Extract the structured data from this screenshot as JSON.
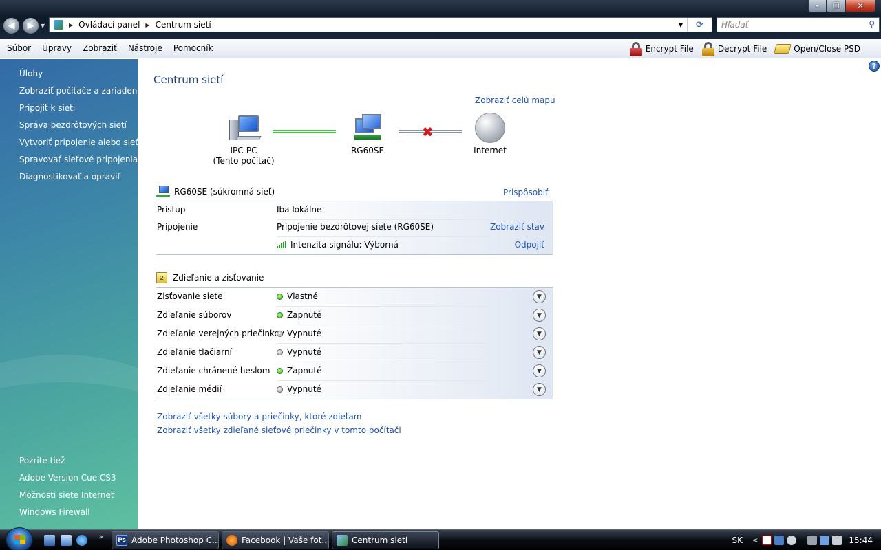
{
  "window": {
    "address": {
      "crumbs": [
        "Ovládací panel",
        "Centrum sietí"
      ]
    },
    "search_placeholder": "Hľadať"
  },
  "menu": {
    "items": [
      "Súbor",
      "Úpravy",
      "Zobraziť",
      "Nástroje",
      "Pomocník"
    ],
    "tools": {
      "encrypt": "Encrypt File",
      "decrypt": "Decrypt File",
      "psd": "Open/Close PSD"
    }
  },
  "sidebar": {
    "tasks_heading": "Úlohy",
    "tasks": [
      "Zobraziť počítače a zariadenia",
      "Pripojiť k sieti",
      "Správa bezdrôtových sietí",
      "Vytvoriť pripojenie alebo sieť",
      "Spravovať sieťové pripojenia",
      "Diagnostikovať a opraviť"
    ],
    "see_also_heading": "Pozrite tiež",
    "see_also": [
      "Adobe Version Cue CS3",
      "Možnosti siete Internet",
      "Windows Firewall"
    ]
  },
  "main": {
    "title": "Centrum sietí",
    "full_map_link": "Zobraziť celú mapu",
    "map": {
      "computer_name": "IPC-PC",
      "computer_sub": "(Tento počítač)",
      "network": "RG60SE",
      "internet": "Internet"
    },
    "network_section": {
      "title": "RG60SE (súkromná sieť)",
      "customize_link": "Prispôsobiť",
      "rows": [
        {
          "label": "Prístup",
          "value": "Iba lokálne",
          "link": ""
        },
        {
          "label": "Pripojenie",
          "value": "Pripojenie bezdrôtovej siete (RG60SE)",
          "link": "Zobraziť stav"
        },
        {
          "label": "",
          "value": "Intenzita signálu: Výborná",
          "link": "Odpojiť"
        }
      ]
    },
    "sharing_section": {
      "title": "Zdieľanie a zisťovanie",
      "rows": [
        {
          "label": "Zisťovanie siete",
          "status": "Vlastné",
          "on": true
        },
        {
          "label": "Zdieľanie súborov",
          "status": "Zapnuté",
          "on": true
        },
        {
          "label": "Zdieľanie verejných priečinkov",
          "status": "Vypnuté",
          "on": false
        },
        {
          "label": "Zdieľanie tlačiarní",
          "status": "Vypnuté",
          "on": false
        },
        {
          "label": "Zdieľanie chránené heslom",
          "status": "Zapnuté",
          "on": true
        },
        {
          "label": "Zdieľanie médií",
          "status": "Vypnuté",
          "on": false
        }
      ]
    },
    "bottom_links": [
      "Zobraziť všetky súbory a priečinky, ktoré zdieľam",
      "Zobraziť všetky zdieľané sieťové priečinky v tomto počítači"
    ]
  },
  "taskbar": {
    "buttons": [
      "Adobe Photoshop C...",
      "Facebook | Vaše fot...",
      "Centrum sietí"
    ],
    "language": "SK",
    "clock": "15:44"
  }
}
